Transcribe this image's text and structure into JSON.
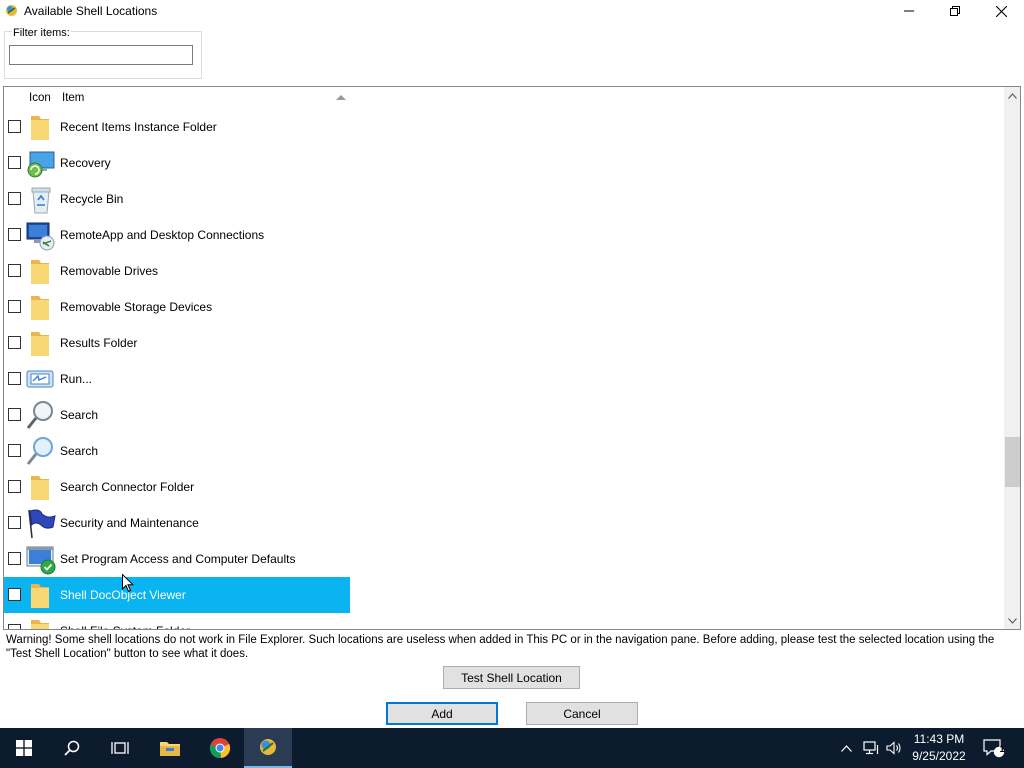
{
  "window": {
    "title": "Available Shell Locations",
    "app_icon": "shell-app-icon",
    "controls": {
      "minimize": "minimize-icon",
      "maximize": "restore-icon",
      "close": "close-icon"
    }
  },
  "filter": {
    "label": "Filter items:",
    "value": "",
    "placeholder": ""
  },
  "list": {
    "columns": {
      "icon": "Icon",
      "item": "Item"
    },
    "sort": "ascending",
    "rows": [
      {
        "label": "Recent Items Instance Folder",
        "icon": "folder-icon",
        "checked": false
      },
      {
        "label": "Recovery",
        "icon": "recovery-icon",
        "checked": false
      },
      {
        "label": "Recycle Bin",
        "icon": "recycle-bin-icon",
        "checked": false
      },
      {
        "label": "RemoteApp and Desktop Connections",
        "icon": "remote-app-icon",
        "checked": false
      },
      {
        "label": "Removable Drives",
        "icon": "folder-icon",
        "checked": false
      },
      {
        "label": "Removable Storage Devices",
        "icon": "folder-icon",
        "checked": false
      },
      {
        "label": "Results Folder",
        "icon": "folder-icon",
        "checked": false
      },
      {
        "label": "Run...",
        "icon": "run-icon",
        "checked": false
      },
      {
        "label": "Search",
        "icon": "search-icon",
        "checked": false
      },
      {
        "label": "Search",
        "icon": "search-light-icon",
        "checked": false
      },
      {
        "label": "Search Connector Folder",
        "icon": "folder-icon",
        "checked": false
      },
      {
        "label": "Security and Maintenance",
        "icon": "flag-icon",
        "checked": false
      },
      {
        "label": "Set Program Access and Computer Defaults",
        "icon": "program-defaults-icon",
        "checked": false
      },
      {
        "label": "Shell DocObject Viewer",
        "icon": "folder-icon",
        "checked": false,
        "selected": true
      },
      {
        "label": "Shell File System Folder",
        "icon": "folder-icon",
        "checked": false
      }
    ]
  },
  "warning": "Warning! Some shell locations do not work in File Explorer. Such locations are useless when added in This PC or in the navigation pane. Before adding, please test the selected location using the \"Test Shell Location\" button to see what it does.",
  "buttons": {
    "test": "Test Shell Location",
    "add": "Add",
    "cancel": "Cancel"
  },
  "taskbar": {
    "items": [
      "start-icon",
      "search-icon",
      "task-view-icon",
      "file-explorer-icon",
      "chrome-icon",
      "shell-app-icon"
    ],
    "time": "11:43 PM",
    "date": "9/25/2022",
    "notification_count": "1"
  },
  "colors": {
    "selection": "#0ab4f0",
    "taskbar": "#0d1b2e",
    "folder": "#f8d775"
  }
}
